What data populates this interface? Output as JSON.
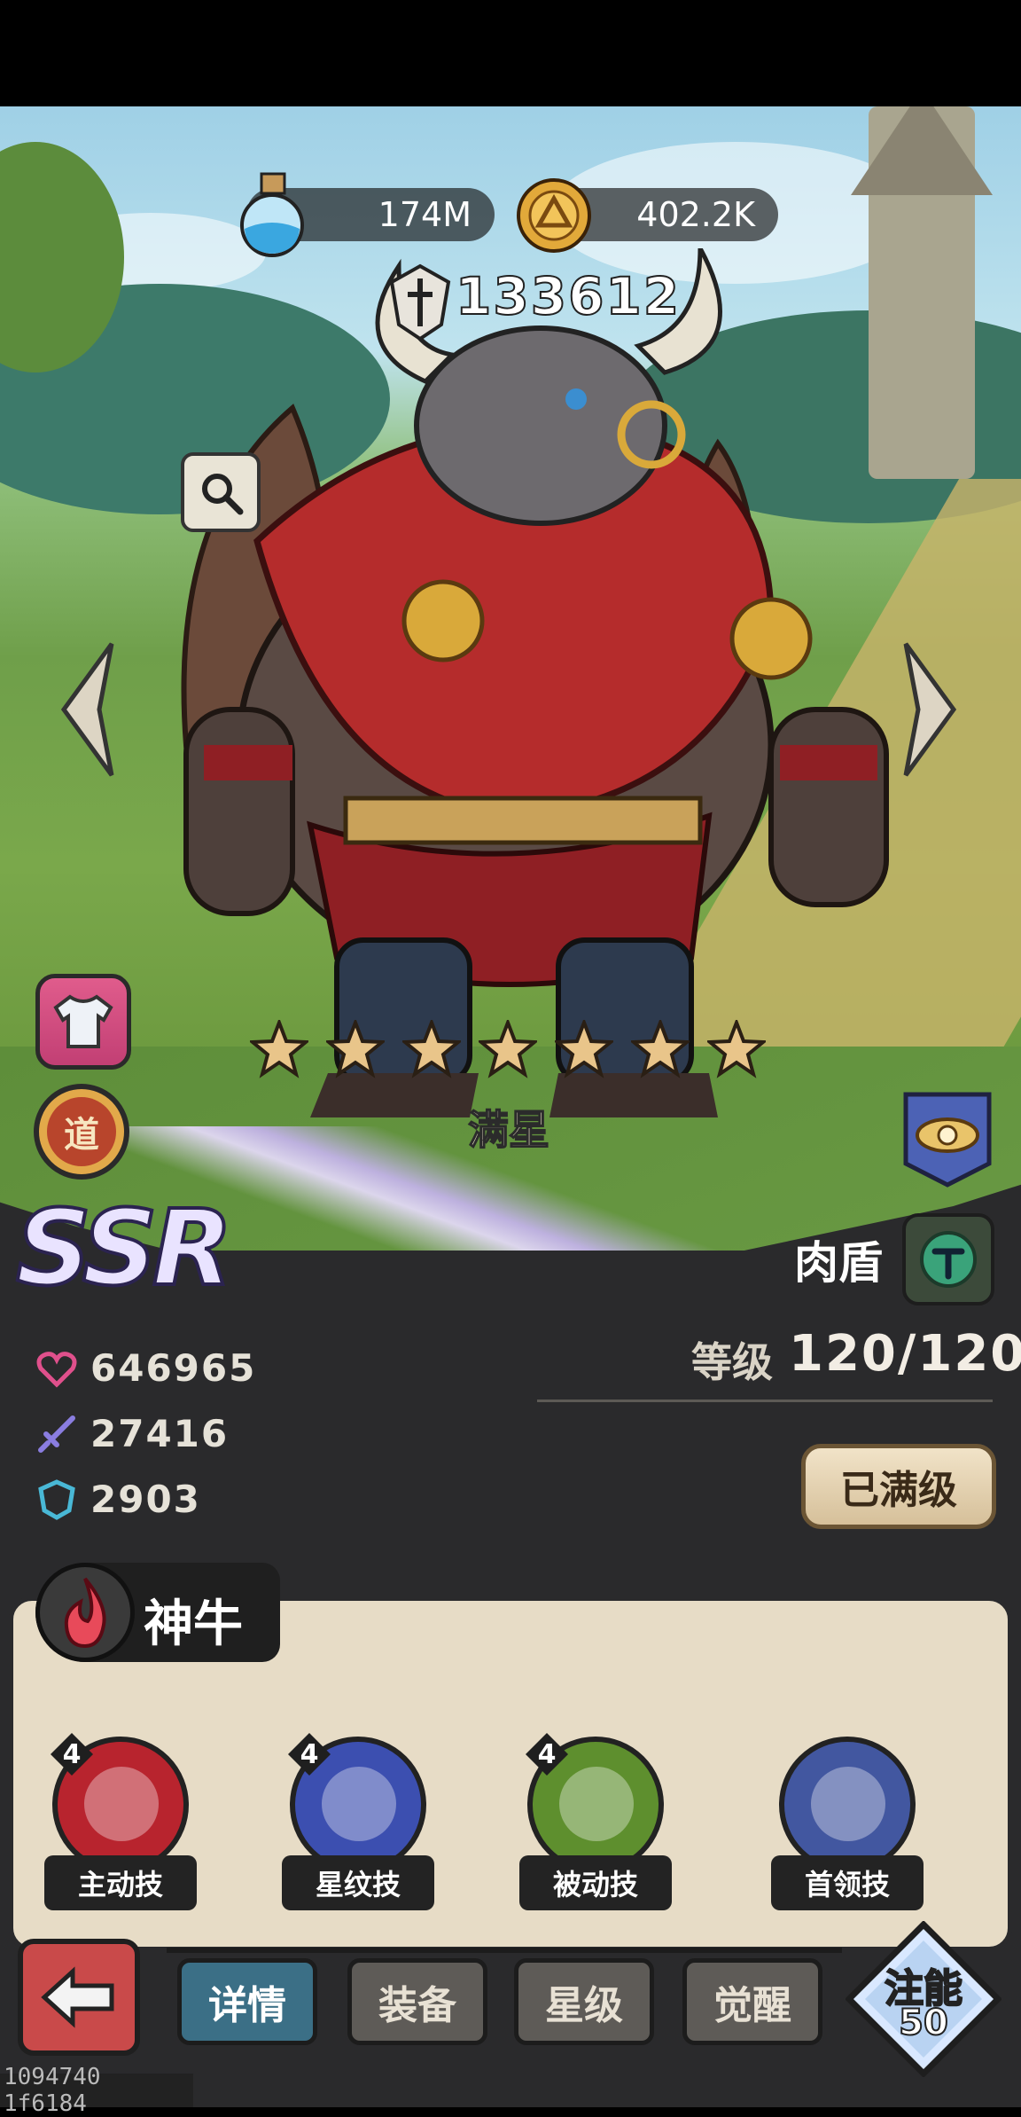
{
  "resources": {
    "potion": "174M",
    "coin": "402.2K"
  },
  "hero": {
    "power": "133612",
    "stars": 7,
    "star_label": "满星",
    "rarity": "SSR",
    "role": "肉盾",
    "seal_label": "道",
    "level_label": "等级",
    "level_value": "120/120",
    "max_level_button": "已满级",
    "name": "神牛",
    "stats": {
      "hp": "646965",
      "attack": "27416",
      "defense": "2903"
    }
  },
  "skills": [
    {
      "label": "主动技",
      "level": "4",
      "color": "#b8242e",
      "icon": "lightning-scroll-icon"
    },
    {
      "label": "星纹技",
      "level": "4",
      "color": "#3c4fb0",
      "icon": "purple-crystal-icon"
    },
    {
      "label": "被动技",
      "level": "4",
      "color": "#5e8f2e",
      "icon": "lightbulb-icon"
    },
    {
      "label": "首领技",
      "level": "",
      "color": "#4257a0",
      "icon": "golden-eye-icon"
    }
  ],
  "tabs": [
    "详情",
    "装备",
    "星级",
    "觉醒"
  ],
  "active_tab": 0,
  "inject": {
    "label_top": "注能",
    "label_bottom": "50"
  },
  "debug_text": "1094740 1f6184"
}
